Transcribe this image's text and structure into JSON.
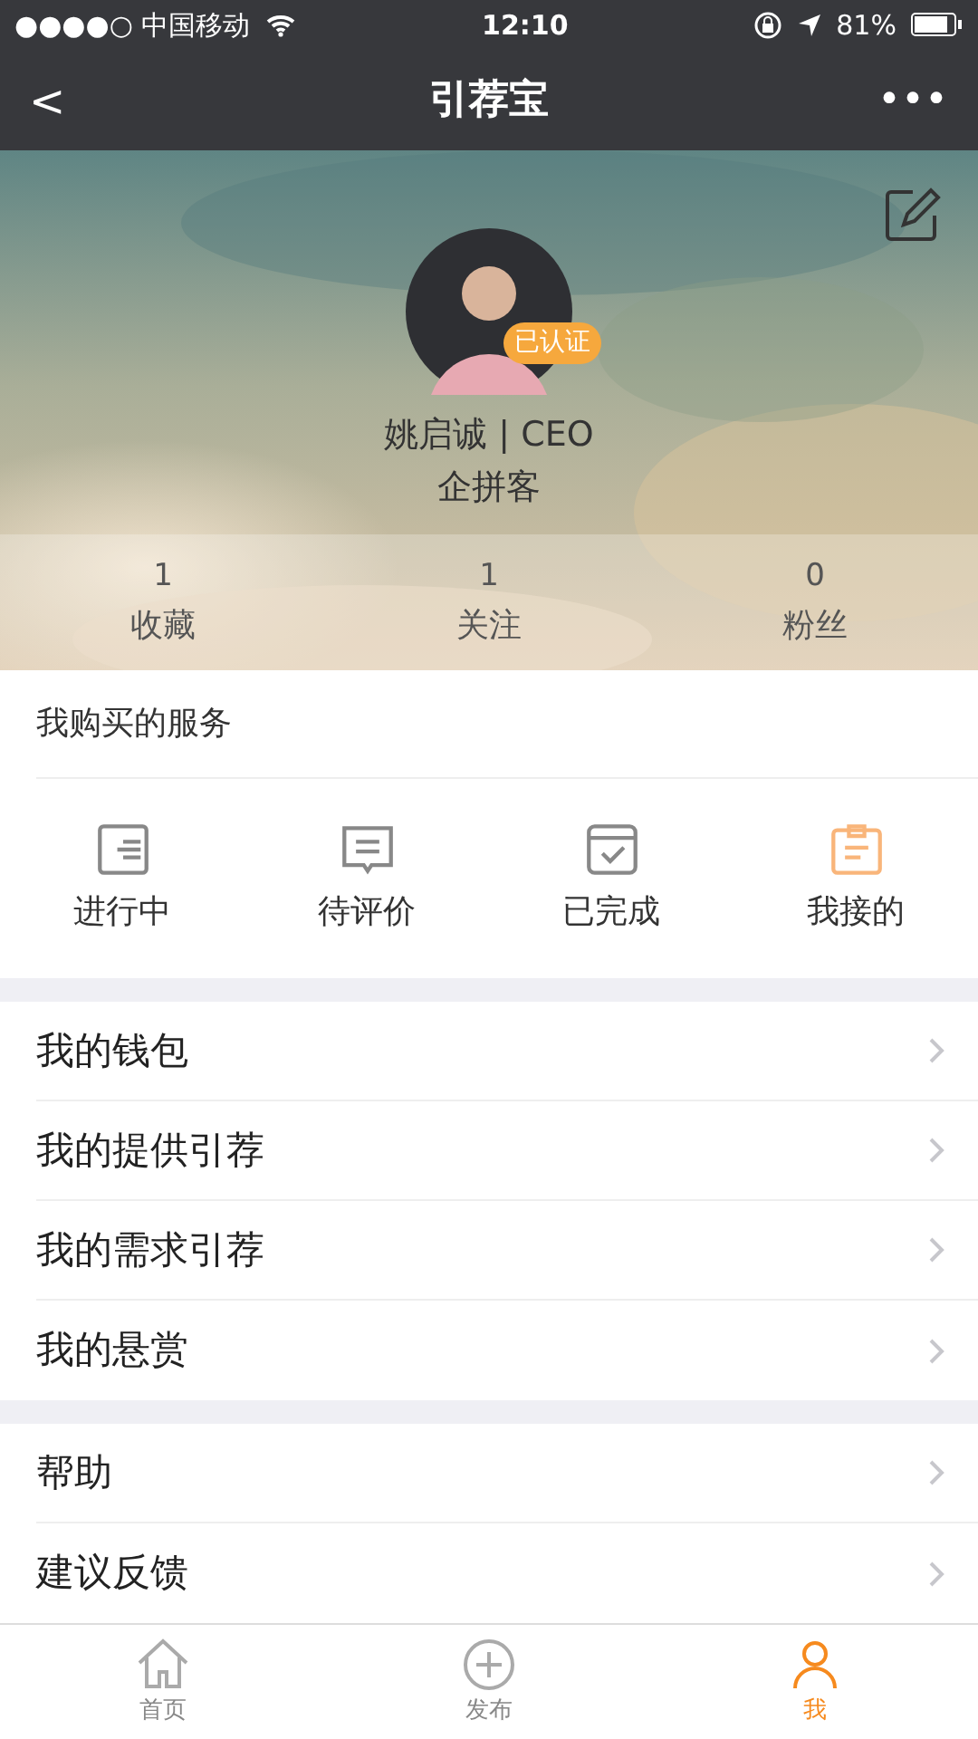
{
  "status_bar": {
    "carrier": "●●●●○ 中国移动",
    "time": "12:10",
    "battery": "81%"
  },
  "nav": {
    "back": "<",
    "title": "引荐宝",
    "more": "•••"
  },
  "profile": {
    "badge": "已认证",
    "name": "姚启诚 | CEO",
    "company": "企拼客"
  },
  "stats": [
    {
      "count": "1",
      "label": "收藏"
    },
    {
      "count": "1",
      "label": "关注"
    },
    {
      "count": "0",
      "label": "粉丝"
    }
  ],
  "services": {
    "title": "我购买的服务",
    "items": [
      {
        "label": "进行中",
        "kind": "progress",
        "highlight": false
      },
      {
        "label": "待评价",
        "kind": "comment",
        "highlight": false
      },
      {
        "label": "已完成",
        "kind": "done",
        "highlight": false
      },
      {
        "label": "我接的",
        "kind": "clipboard",
        "highlight": true
      }
    ]
  },
  "menu_groups": [
    [
      {
        "label": "我的钱包"
      },
      {
        "label": "我的提供引荐"
      },
      {
        "label": "我的需求引荐"
      },
      {
        "label": "我的悬赏"
      }
    ],
    [
      {
        "label": "帮助"
      },
      {
        "label": "建议反馈"
      }
    ]
  ],
  "tabs": [
    {
      "label": "首页",
      "kind": "home",
      "selected": false
    },
    {
      "label": "发布",
      "kind": "add",
      "selected": false
    },
    {
      "label": "我",
      "kind": "me",
      "selected": true
    }
  ]
}
